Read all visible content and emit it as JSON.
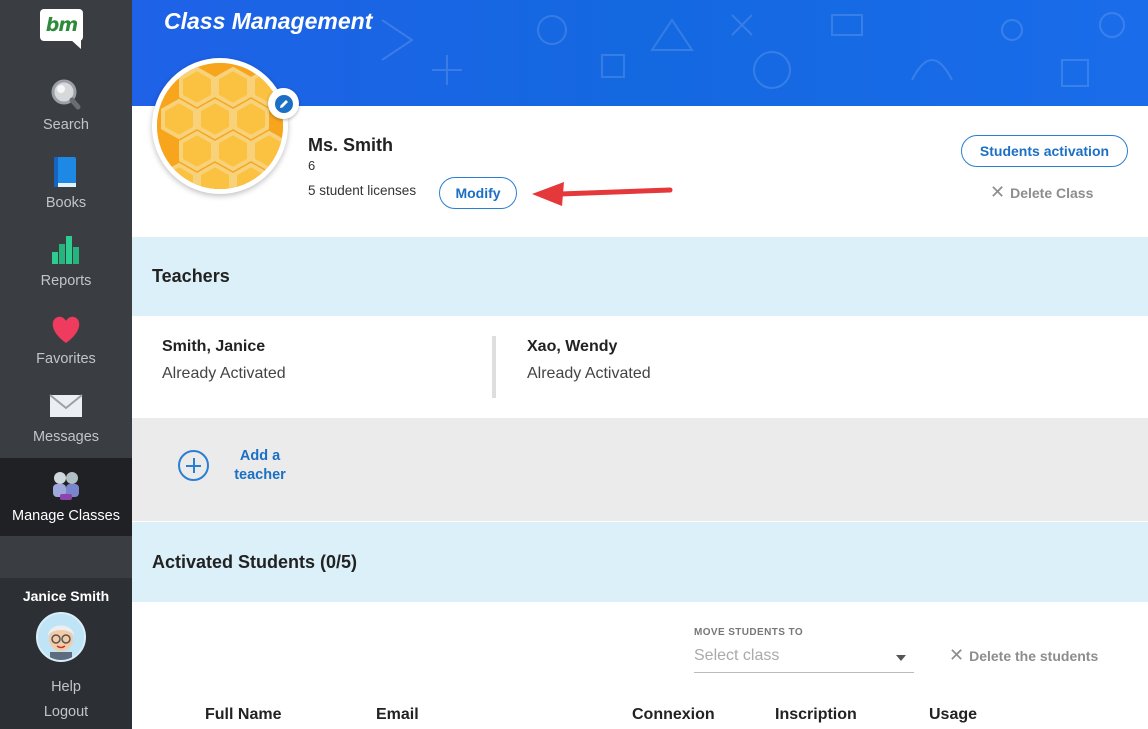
{
  "sidebar": {
    "logo_text": "bm",
    "items": [
      {
        "label": "Search",
        "icon": "search-icon"
      },
      {
        "label": "Books",
        "icon": "book-icon"
      },
      {
        "label": "Reports",
        "icon": "bar-chart-icon"
      },
      {
        "label": "Favorites",
        "icon": "heart-icon"
      },
      {
        "label": "Messages",
        "icon": "envelope-icon"
      },
      {
        "label": "Manage Classes",
        "icon": "manage-classes-icon",
        "active": true
      }
    ],
    "user_name": "Janice Smith",
    "help_label": "Help",
    "logout_label": "Logout"
  },
  "header": {
    "title": "Class Management"
  },
  "class_info": {
    "name": "Ms. Smith",
    "grade": "6",
    "licenses": "5 student licenses",
    "modify_label": "Modify",
    "activation_label": "Students activation",
    "delete_class_label": "Delete Class"
  },
  "teachers": {
    "title": "Teachers",
    "list": [
      {
        "name": "Smith, Janice",
        "status": "Already Activated"
      },
      {
        "name": "Xao, Wendy",
        "status": "Already Activated"
      }
    ],
    "add_label_line1": "Add a",
    "add_label_line2": "teacher"
  },
  "students": {
    "title": "Activated Students (0/5)",
    "move_label": "MOVE STUDENTS TO",
    "select_placeholder": "Select class",
    "delete_label": "Delete the students",
    "columns": [
      "Full Name",
      "Email",
      "Connexion",
      "Inscription",
      "Usage"
    ]
  },
  "colors": {
    "sidebar_bg": "#3a3d41",
    "banner_blue": "#1468e0",
    "accent_blue": "#2a7fd4",
    "section_bg": "#dcf0fa",
    "annotation_arrow": "#e5383b"
  }
}
